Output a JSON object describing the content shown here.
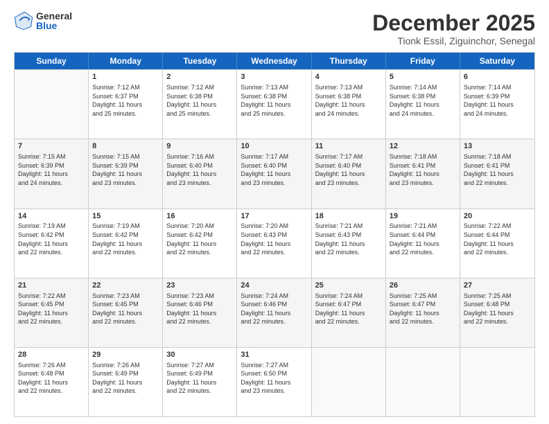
{
  "logo": {
    "general": "General",
    "blue": "Blue"
  },
  "title": "December 2025",
  "subtitle": "Tionk Essil, Ziguinchor, Senegal",
  "header_days": [
    "Sunday",
    "Monday",
    "Tuesday",
    "Wednesday",
    "Thursday",
    "Friday",
    "Saturday"
  ],
  "rows": [
    [
      {
        "day": "",
        "info": ""
      },
      {
        "day": "1",
        "info": "Sunrise: 7:12 AM\nSunset: 6:37 PM\nDaylight: 11 hours\nand 25 minutes."
      },
      {
        "day": "2",
        "info": "Sunrise: 7:12 AM\nSunset: 6:38 PM\nDaylight: 11 hours\nand 25 minutes."
      },
      {
        "day": "3",
        "info": "Sunrise: 7:13 AM\nSunset: 6:38 PM\nDaylight: 11 hours\nand 25 minutes."
      },
      {
        "day": "4",
        "info": "Sunrise: 7:13 AM\nSunset: 6:38 PM\nDaylight: 11 hours\nand 24 minutes."
      },
      {
        "day": "5",
        "info": "Sunrise: 7:14 AM\nSunset: 6:38 PM\nDaylight: 11 hours\nand 24 minutes."
      },
      {
        "day": "6",
        "info": "Sunrise: 7:14 AM\nSunset: 6:39 PM\nDaylight: 11 hours\nand 24 minutes."
      }
    ],
    [
      {
        "day": "7",
        "info": "Sunrise: 7:15 AM\nSunset: 6:39 PM\nDaylight: 11 hours\nand 24 minutes."
      },
      {
        "day": "8",
        "info": "Sunrise: 7:15 AM\nSunset: 6:39 PM\nDaylight: 11 hours\nand 23 minutes."
      },
      {
        "day": "9",
        "info": "Sunrise: 7:16 AM\nSunset: 6:40 PM\nDaylight: 11 hours\nand 23 minutes."
      },
      {
        "day": "10",
        "info": "Sunrise: 7:17 AM\nSunset: 6:40 PM\nDaylight: 11 hours\nand 23 minutes."
      },
      {
        "day": "11",
        "info": "Sunrise: 7:17 AM\nSunset: 6:40 PM\nDaylight: 11 hours\nand 23 minutes."
      },
      {
        "day": "12",
        "info": "Sunrise: 7:18 AM\nSunset: 6:41 PM\nDaylight: 11 hours\nand 23 minutes."
      },
      {
        "day": "13",
        "info": "Sunrise: 7:18 AM\nSunset: 6:41 PM\nDaylight: 11 hours\nand 22 minutes."
      }
    ],
    [
      {
        "day": "14",
        "info": "Sunrise: 7:19 AM\nSunset: 6:42 PM\nDaylight: 11 hours\nand 22 minutes."
      },
      {
        "day": "15",
        "info": "Sunrise: 7:19 AM\nSunset: 6:42 PM\nDaylight: 11 hours\nand 22 minutes."
      },
      {
        "day": "16",
        "info": "Sunrise: 7:20 AM\nSunset: 6:42 PM\nDaylight: 11 hours\nand 22 minutes."
      },
      {
        "day": "17",
        "info": "Sunrise: 7:20 AM\nSunset: 6:43 PM\nDaylight: 11 hours\nand 22 minutes."
      },
      {
        "day": "18",
        "info": "Sunrise: 7:21 AM\nSunset: 6:43 PM\nDaylight: 11 hours\nand 22 minutes."
      },
      {
        "day": "19",
        "info": "Sunrise: 7:21 AM\nSunset: 6:44 PM\nDaylight: 11 hours\nand 22 minutes."
      },
      {
        "day": "20",
        "info": "Sunrise: 7:22 AM\nSunset: 6:44 PM\nDaylight: 11 hours\nand 22 minutes."
      }
    ],
    [
      {
        "day": "21",
        "info": "Sunrise: 7:22 AM\nSunset: 6:45 PM\nDaylight: 11 hours\nand 22 minutes."
      },
      {
        "day": "22",
        "info": "Sunrise: 7:23 AM\nSunset: 6:45 PM\nDaylight: 11 hours\nand 22 minutes."
      },
      {
        "day": "23",
        "info": "Sunrise: 7:23 AM\nSunset: 6:46 PM\nDaylight: 11 hours\nand 22 minutes."
      },
      {
        "day": "24",
        "info": "Sunrise: 7:24 AM\nSunset: 6:46 PM\nDaylight: 11 hours\nand 22 minutes."
      },
      {
        "day": "25",
        "info": "Sunrise: 7:24 AM\nSunset: 6:47 PM\nDaylight: 11 hours\nand 22 minutes."
      },
      {
        "day": "26",
        "info": "Sunrise: 7:25 AM\nSunset: 6:47 PM\nDaylight: 11 hours\nand 22 minutes."
      },
      {
        "day": "27",
        "info": "Sunrise: 7:25 AM\nSunset: 6:48 PM\nDaylight: 11 hours\nand 22 minutes."
      }
    ],
    [
      {
        "day": "28",
        "info": "Sunrise: 7:26 AM\nSunset: 6:48 PM\nDaylight: 11 hours\nand 22 minutes."
      },
      {
        "day": "29",
        "info": "Sunrise: 7:26 AM\nSunset: 6:49 PM\nDaylight: 11 hours\nand 22 minutes."
      },
      {
        "day": "30",
        "info": "Sunrise: 7:27 AM\nSunset: 6:49 PM\nDaylight: 11 hours\nand 22 minutes."
      },
      {
        "day": "31",
        "info": "Sunrise: 7:27 AM\nSunset: 6:50 PM\nDaylight: 11 hours\nand 23 minutes."
      },
      {
        "day": "",
        "info": ""
      },
      {
        "day": "",
        "info": ""
      },
      {
        "day": "",
        "info": ""
      }
    ]
  ]
}
